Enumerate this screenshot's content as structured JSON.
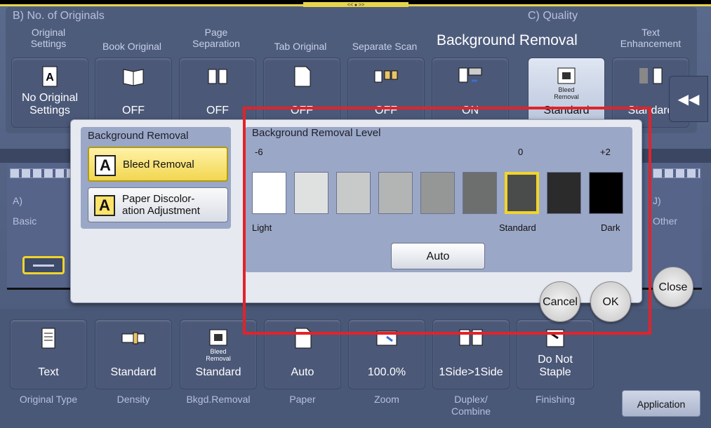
{
  "header": {
    "section_b": "B)  No. of Originals",
    "section_c": "C)  Quality",
    "top_tab": "<< ● >>"
  },
  "top_columns": [
    {
      "label": "Original\nSettings",
      "value": "No Original\nSettings",
      "icon": "original-settings-icon"
    },
    {
      "label": "Book Original",
      "value": "OFF",
      "icon": "book-icon"
    },
    {
      "label": "Page\nSeparation",
      "value": "OFF",
      "icon": "page-separation-icon"
    },
    {
      "label": "Tab Original",
      "value": "OFF",
      "icon": "tab-original-icon"
    },
    {
      "label": "Separate Scan",
      "value": "OFF",
      "icon": "separate-scan-icon"
    },
    {
      "label": "Background Removal",
      "value": "ON",
      "icon": "scan-icon"
    }
  ],
  "quality_tiles": [
    {
      "sub": "Bleed\nRemoval",
      "value": "Standard",
      "icon": "bleed-removal-icon"
    },
    {
      "label": "Text\nEnhancement",
      "value": "Standard",
      "icon": "text-enhancement-icon"
    }
  ],
  "quality_popup_title": "Background Removal",
  "middle": {
    "a_label": "A)",
    "basic_label": "Basic",
    "j_label": "J)",
    "other_label": "Other"
  },
  "bottom_tiles": [
    {
      "value": "Text",
      "label": "Original Type",
      "icon": "original-type-icon"
    },
    {
      "value": "Standard",
      "label": "Density",
      "icon": "density-icon"
    },
    {
      "sub": "Bleed\nRemoval",
      "value": "Standard",
      "label": "Bkgd.Removal",
      "icon": "bleed-removal-icon"
    },
    {
      "value": "Auto",
      "label": "Paper",
      "icon": "paper-icon"
    },
    {
      "value": "100.0%",
      "label": "Zoom",
      "icon": "zoom-icon"
    },
    {
      "value": "1Side>1Side",
      "label": "Duplex/\nCombine",
      "icon": "duplex-icon"
    },
    {
      "value": "Do Not\nStaple",
      "label": "Finishing",
      "icon": "staple-icon"
    }
  ],
  "application_button": "Application",
  "close_button": "Close",
  "dialog": {
    "left_title": "Background Removal",
    "modes": [
      {
        "label": "Bleed Removal",
        "letter": "A",
        "selected": true
      },
      {
        "label": "Paper Discolor-\nation Adjustment",
        "letter": "A",
        "selected": false
      }
    ],
    "right_title": "Background Removal Level",
    "level_min": "-6",
    "level_zero": "0",
    "level_max": "+2",
    "light_label": "Light",
    "standard_label": "Standard",
    "dark_label": "Dark",
    "swatches": [
      "#ffffff",
      "#dfe1e1",
      "#c8caca",
      "#b3b5b5",
      "#959797",
      "#6d6f6f",
      "#4a4c4c",
      "#2b2b2b",
      "#000000"
    ],
    "selected_level": 6,
    "auto_button": "Auto",
    "cancel_button": "Cancel",
    "ok_button": "OK"
  },
  "colors": {
    "highlight": "#e2232a",
    "selection": "#f1d52a"
  }
}
